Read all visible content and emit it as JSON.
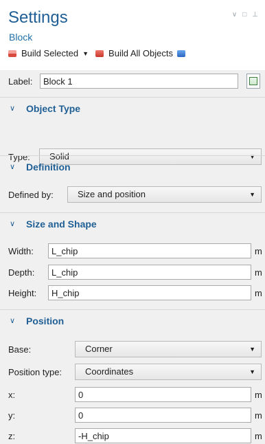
{
  "header": {
    "title": "Settings",
    "subtitle": "Block",
    "build_selected": "Build Selected",
    "build_all": "Build All Objects"
  },
  "label_field": {
    "label": "Label:",
    "value": "Block 1"
  },
  "object_type": {
    "section": "Object Type",
    "type_label": "Type:",
    "type_value": "Solid"
  },
  "definition": {
    "section": "Definition",
    "defined_by_label": "Defined by:",
    "defined_by_value": "Size and position"
  },
  "size_shape": {
    "section": "Size and Shape",
    "width_label": "Width:",
    "width_value": "L_chip",
    "depth_label": "Depth:",
    "depth_value": "L_chip",
    "height_label": "Height:",
    "height_value": "H_chip",
    "unit": "m"
  },
  "position": {
    "section": "Position",
    "base_label": "Base:",
    "base_value": "Corner",
    "position_type_label": "Position type:",
    "position_type_value": "Coordinates",
    "x_label": "x:",
    "x_value": "0",
    "y_label": "y:",
    "y_value": "0",
    "z_label": "z:",
    "z_value": "-H_chip",
    "unit": "m"
  },
  "colors": {
    "accent": "#1f5f95",
    "panel_bg": "#f0f0f0"
  }
}
